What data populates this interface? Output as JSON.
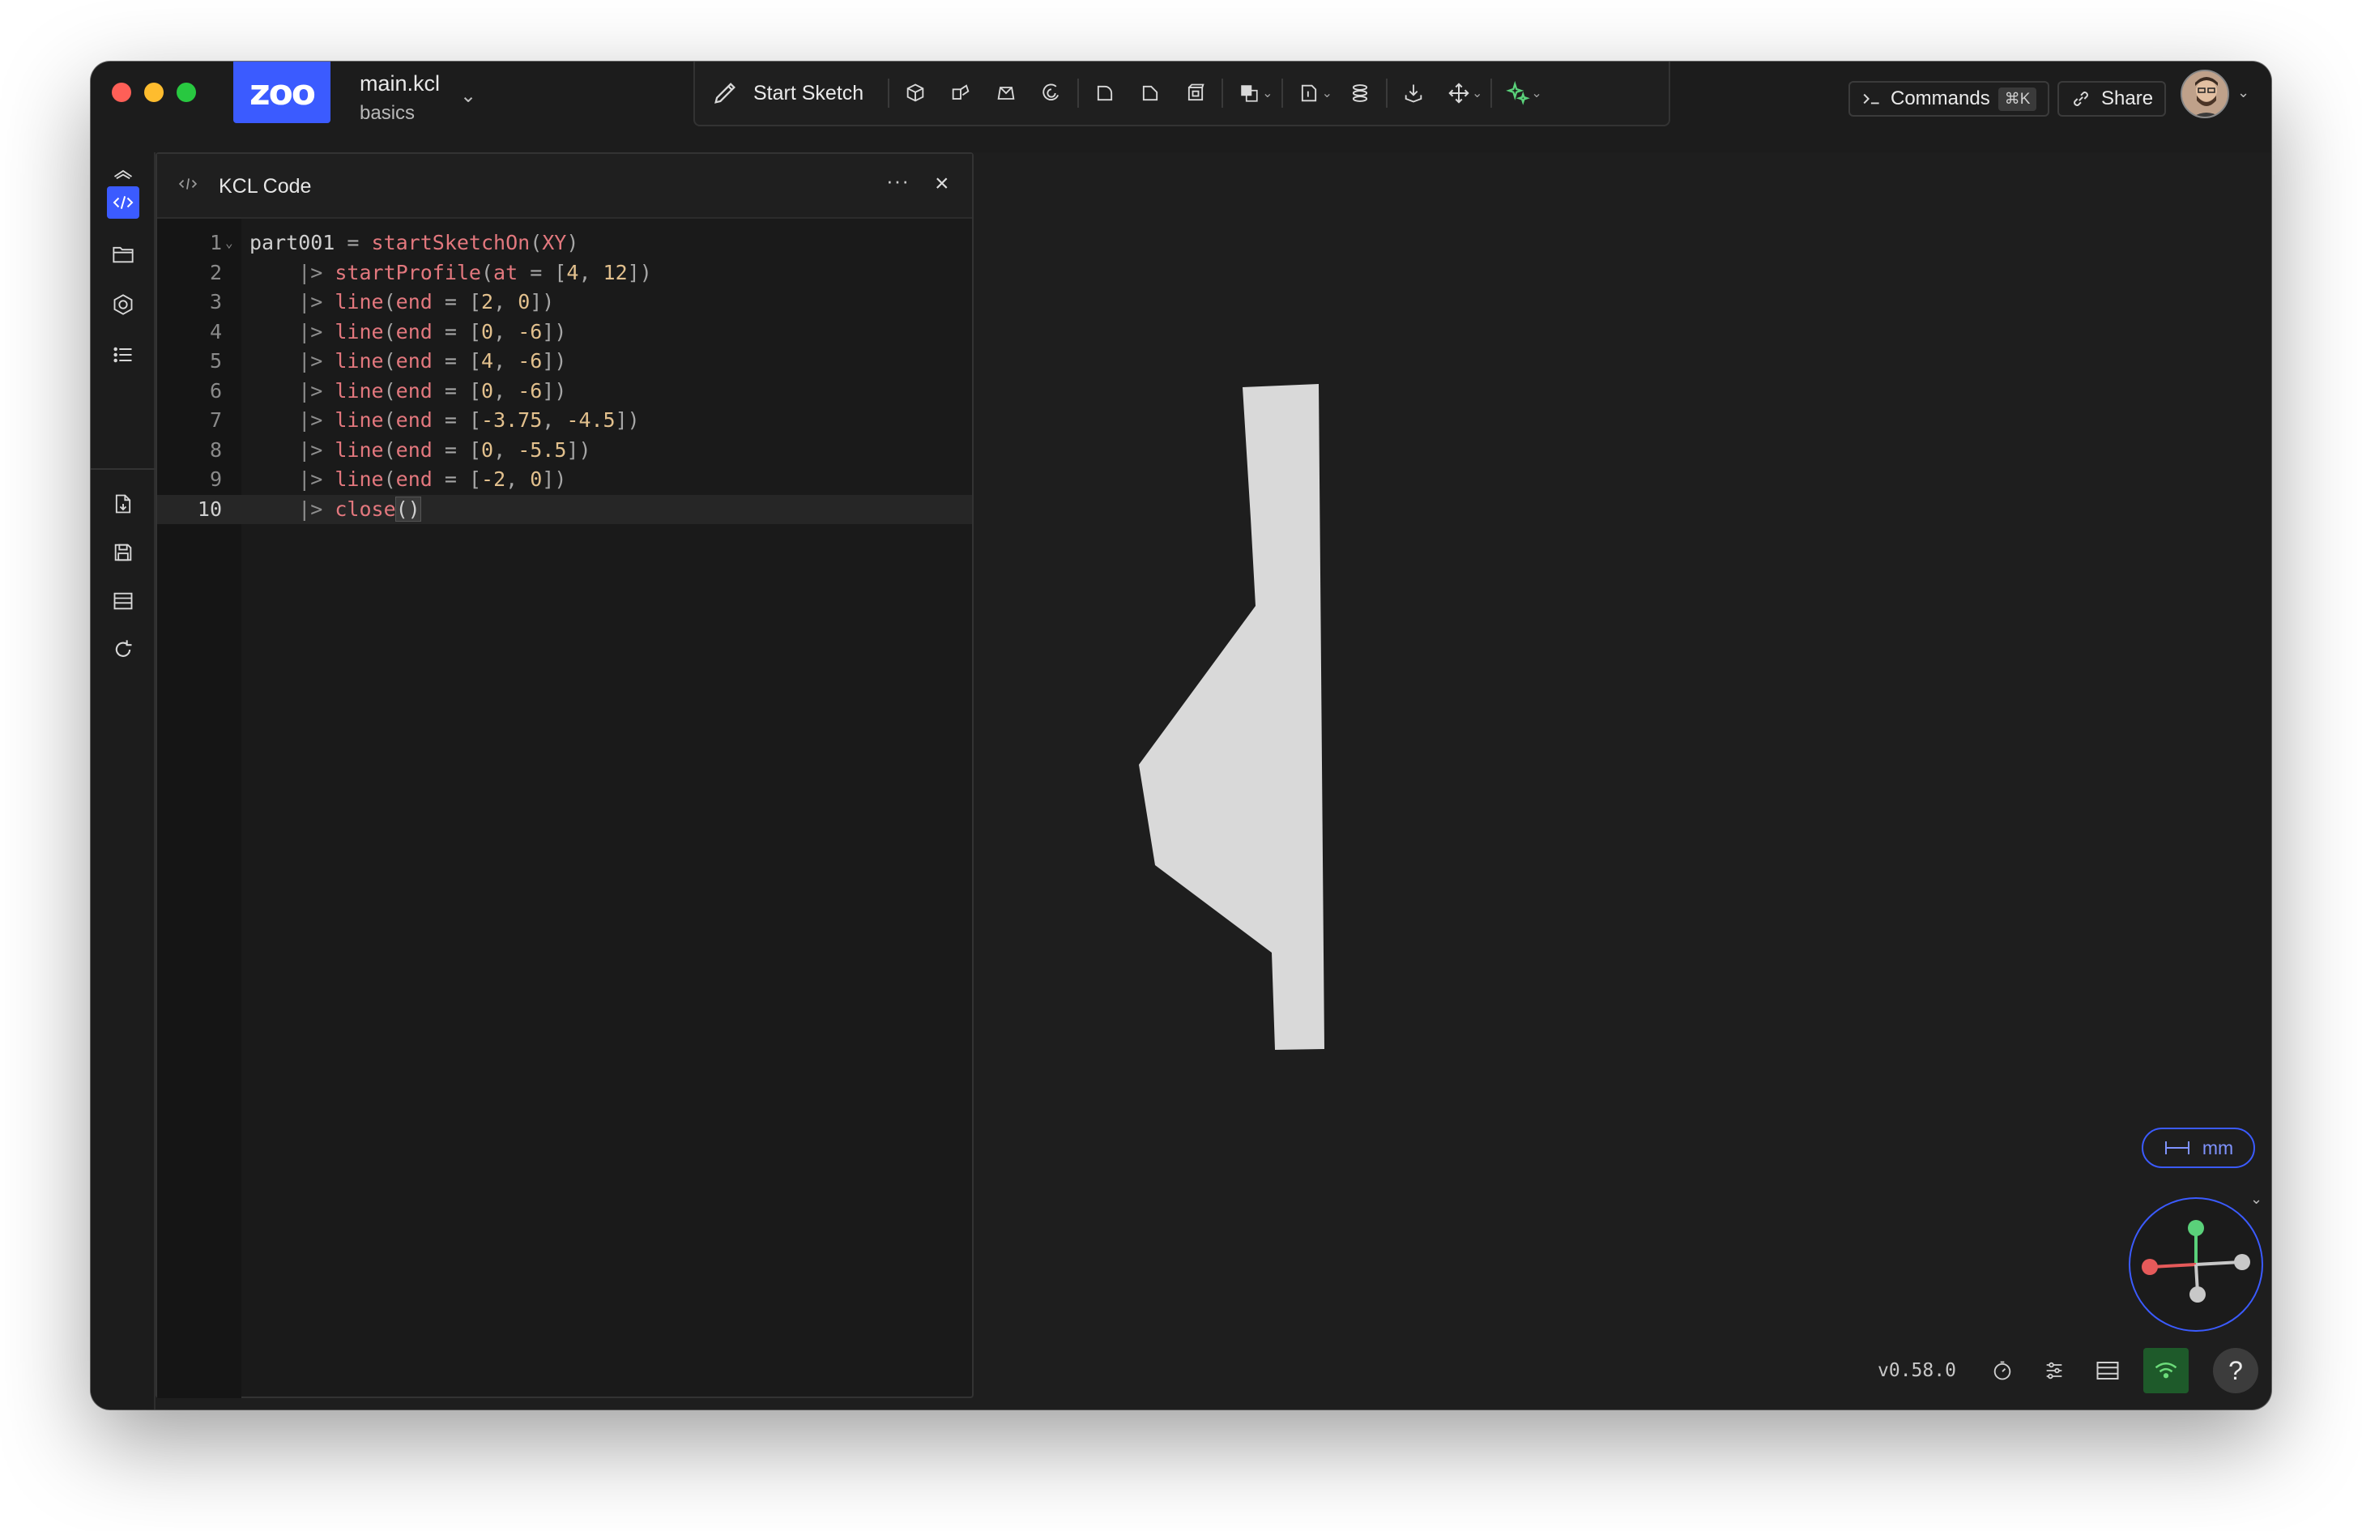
{
  "app": {
    "logo_text": "zoo",
    "file_name": "main.kcl",
    "project_name": "basics"
  },
  "toolbar": {
    "start_sketch_label": "Start Sketch",
    "tools": [
      "extrude-icon",
      "sweep-icon",
      "loft-icon",
      "revolve-icon",
      "fillet-icon",
      "chamfer-icon",
      "shell-icon",
      "boolean-icon",
      "plane-icon",
      "helix-icon",
      "insert-icon",
      "transform-icon",
      "ai-icon"
    ]
  },
  "header": {
    "commands_label": "Commands",
    "commands_shortcut": "⌘K",
    "share_label": "Share"
  },
  "panel": {
    "title": "KCL Code",
    "more_label": "···",
    "close_label": "×"
  },
  "code": {
    "lines": [
      {
        "n": "1",
        "tokens": [
          [
            "t-var",
            "part001"
          ],
          [
            "t-op",
            " = "
          ],
          [
            "t-fn",
            "startSketchOn"
          ],
          [
            "t-op",
            "("
          ],
          [
            "t-fn",
            "XY"
          ],
          [
            "t-op",
            ")"
          ]
        ]
      },
      {
        "n": "2",
        "tokens": [
          [
            "t-pipe",
            "    |> "
          ],
          [
            "t-fn",
            "startProfile"
          ],
          [
            "t-op",
            "("
          ],
          [
            "t-fn",
            "at"
          ],
          [
            "t-op",
            " = ["
          ],
          [
            "t-num",
            "4"
          ],
          [
            "t-op",
            ", "
          ],
          [
            "t-num",
            "12"
          ],
          [
            "t-op",
            "])"
          ]
        ]
      },
      {
        "n": "3",
        "tokens": [
          [
            "t-pipe",
            "    |> "
          ],
          [
            "t-fn",
            "line"
          ],
          [
            "t-op",
            "("
          ],
          [
            "t-fn",
            "end"
          ],
          [
            "t-op",
            " = ["
          ],
          [
            "t-num",
            "2"
          ],
          [
            "t-op",
            ", "
          ],
          [
            "t-num",
            "0"
          ],
          [
            "t-op",
            "])"
          ]
        ]
      },
      {
        "n": "4",
        "tokens": [
          [
            "t-pipe",
            "    |> "
          ],
          [
            "t-fn",
            "line"
          ],
          [
            "t-op",
            "("
          ],
          [
            "t-fn",
            "end"
          ],
          [
            "t-op",
            " = ["
          ],
          [
            "t-num",
            "0"
          ],
          [
            "t-op",
            ", "
          ],
          [
            "t-num",
            "-6"
          ],
          [
            "t-op",
            "])"
          ]
        ]
      },
      {
        "n": "5",
        "tokens": [
          [
            "t-pipe",
            "    |> "
          ],
          [
            "t-fn",
            "line"
          ],
          [
            "t-op",
            "("
          ],
          [
            "t-fn",
            "end"
          ],
          [
            "t-op",
            " = ["
          ],
          [
            "t-num",
            "4"
          ],
          [
            "t-op",
            ", "
          ],
          [
            "t-num",
            "-6"
          ],
          [
            "t-op",
            "])"
          ]
        ]
      },
      {
        "n": "6",
        "tokens": [
          [
            "t-pipe",
            "    |> "
          ],
          [
            "t-fn",
            "line"
          ],
          [
            "t-op",
            "("
          ],
          [
            "t-fn",
            "end"
          ],
          [
            "t-op",
            " = ["
          ],
          [
            "t-num",
            "0"
          ],
          [
            "t-op",
            ", "
          ],
          [
            "t-num",
            "-6"
          ],
          [
            "t-op",
            "])"
          ]
        ]
      },
      {
        "n": "7",
        "tokens": [
          [
            "t-pipe",
            "    |> "
          ],
          [
            "t-fn",
            "line"
          ],
          [
            "t-op",
            "("
          ],
          [
            "t-fn",
            "end"
          ],
          [
            "t-op",
            " = ["
          ],
          [
            "t-num",
            "-3.75"
          ],
          [
            "t-op",
            ", "
          ],
          [
            "t-num",
            "-4.5"
          ],
          [
            "t-op",
            "])"
          ]
        ]
      },
      {
        "n": "8",
        "tokens": [
          [
            "t-pipe",
            "    |> "
          ],
          [
            "t-fn",
            "line"
          ],
          [
            "t-op",
            "("
          ],
          [
            "t-fn",
            "end"
          ],
          [
            "t-op",
            " = ["
          ],
          [
            "t-num",
            "0"
          ],
          [
            "t-op",
            ", "
          ],
          [
            "t-num",
            "-5.5"
          ],
          [
            "t-op",
            "])"
          ]
        ]
      },
      {
        "n": "9",
        "tokens": [
          [
            "t-pipe",
            "    |> "
          ],
          [
            "t-fn",
            "line"
          ],
          [
            "t-op",
            "("
          ],
          [
            "t-fn",
            "end"
          ],
          [
            "t-op",
            " = ["
          ],
          [
            "t-num",
            "-2"
          ],
          [
            "t-op",
            ", "
          ],
          [
            "t-num",
            "0"
          ],
          [
            "t-op",
            "])"
          ]
        ]
      },
      {
        "n": "10",
        "tokens": [
          [
            "t-pipe",
            "    |> "
          ],
          [
            "t-fn",
            "close"
          ],
          [
            "t-paren-hl",
            "()"
          ]
        ],
        "active": true
      }
    ]
  },
  "viewport": {
    "units_label": "mm",
    "shape_fill": "#d9d9d9",
    "axis_colors": {
      "x": "#e65a5a",
      "y": "#5ad17a",
      "z": "#c8c8c8"
    }
  },
  "status": {
    "version": "v0.58.0"
  },
  "colors": {
    "accent": "#3b5bff",
    "background": "#1e1e1e",
    "network_ok": "#6cdc7a"
  }
}
